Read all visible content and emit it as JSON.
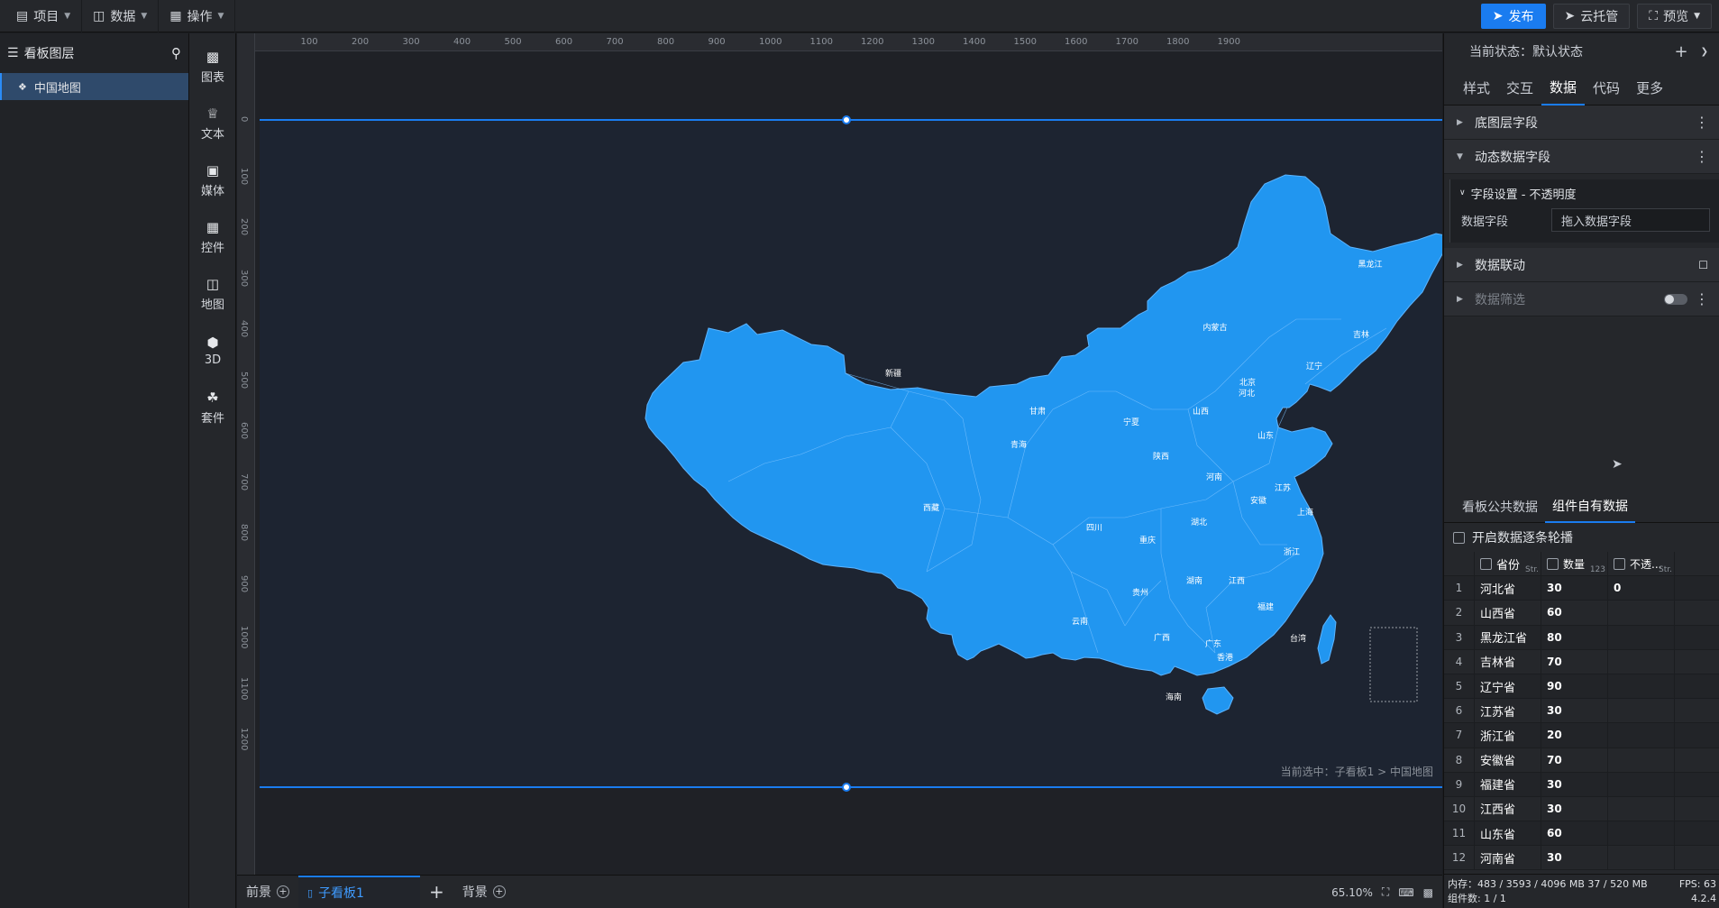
{
  "topbar": {
    "menus": [
      {
        "icon": "file-icon",
        "label": "项目"
      },
      {
        "icon": "database-icon",
        "label": "数据"
      },
      {
        "icon": "grid-icon",
        "label": "操作"
      }
    ],
    "publish_label": "发布",
    "cloud_label": "云托管",
    "preview_label": "预览"
  },
  "layers": {
    "title": "看板图层",
    "items": [
      {
        "label": "中国地图",
        "icon": "map-layer-icon"
      }
    ]
  },
  "tools": [
    {
      "label": "图表",
      "icon": "chart-icon"
    },
    {
      "label": "文本",
      "icon": "text-icon"
    },
    {
      "label": "媒体",
      "icon": "media-icon"
    },
    {
      "label": "控件",
      "icon": "control-icon"
    },
    {
      "label": "地图",
      "icon": "map-icon"
    },
    {
      "label": "3D",
      "icon": "cube-icon"
    },
    {
      "label": "套件",
      "icon": "kit-icon"
    }
  ],
  "ruler": {
    "top_ticks": [
      "100",
      "200",
      "300",
      "400",
      "500",
      "600",
      "700",
      "800",
      "900",
      "1000",
      "1100",
      "1200",
      "1300",
      "1400",
      "1500",
      "1600",
      "1700",
      "1800",
      "1900"
    ],
    "left_ticks": [
      "0",
      "100",
      "200",
      "300",
      "400",
      "500",
      "600",
      "700",
      "800",
      "900",
      "1000",
      "1100",
      "1200"
    ]
  },
  "map": {
    "provinces": [
      "黑龙江",
      "吉林",
      "辽宁",
      "内蒙古",
      "北京",
      "河北",
      "山西",
      "山东",
      "新疆",
      "甘肃",
      "宁夏",
      "青海",
      "陕西",
      "河南",
      "江苏",
      "安徽",
      "上海",
      "西藏",
      "四川",
      "重庆",
      "湖北",
      "浙江",
      "湖南",
      "江西",
      "贵州",
      "福建",
      "云南",
      "广西",
      "广东",
      "台湾",
      "香港",
      "海南"
    ],
    "fill_color": "#2196f0"
  },
  "canvas": {
    "selection_path": "当前选中：子看板1 > 中国地图"
  },
  "bottombar": {
    "tabs": [
      "前景",
      "子看板1",
      "背景"
    ],
    "zoom": "65.10%"
  },
  "right": {
    "state_label": "当前状态：默认状态",
    "tabs": [
      "样式",
      "交互",
      "数据",
      "代码",
      "更多"
    ],
    "sections": {
      "base_fields": "底图层字段",
      "dynamic_fields": "动态数据字段",
      "field_setting": "字段设置 - 不透明度",
      "data_field_label": "数据字段",
      "data_field_placeholder": "拖入数据字段",
      "linkage": "数据联动",
      "filter": "数据筛选"
    },
    "data_tabs": [
      "看板公共数据",
      "组件自有数据"
    ],
    "carousel_label": "开启数据逐条轮播",
    "columns": [
      {
        "name": "省份",
        "type": "Str."
      },
      {
        "name": "数量",
        "type": "123"
      },
      {
        "name": "不透...",
        "type": "Str."
      }
    ],
    "rows": [
      [
        "1",
        "河北省",
        "30",
        "0"
      ],
      [
        "2",
        "山西省",
        "60",
        ""
      ],
      [
        "3",
        "黑龙江省",
        "80",
        ""
      ],
      [
        "4",
        "吉林省",
        "70",
        ""
      ],
      [
        "5",
        "辽宁省",
        "90",
        ""
      ],
      [
        "6",
        "江苏省",
        "30",
        ""
      ],
      [
        "7",
        "浙江省",
        "20",
        ""
      ],
      [
        "8",
        "安徽省",
        "70",
        ""
      ],
      [
        "9",
        "福建省",
        "30",
        ""
      ],
      [
        "10",
        "江西省",
        "30",
        ""
      ],
      [
        "11",
        "山东省",
        "60",
        ""
      ],
      [
        "12",
        "河南省",
        "30",
        ""
      ]
    ],
    "status": {
      "memory": "内存：483 / 3593 / 4096 MB  37 / 520 MB",
      "fps": "FPS: 63",
      "count": "组件数: 1 / 1",
      "version": "4.2.4"
    }
  }
}
